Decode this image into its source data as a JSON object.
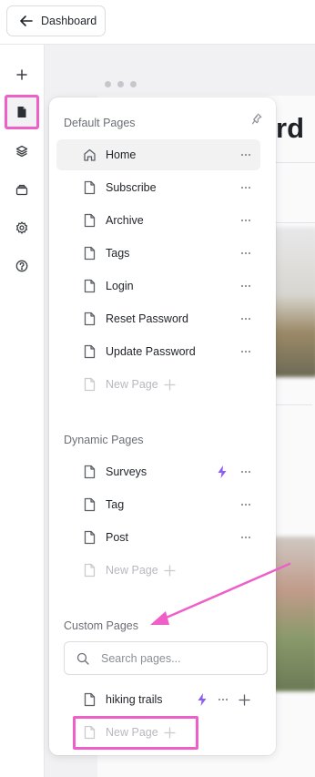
{
  "topbar": {
    "back_label": "Dashboard"
  },
  "canvas": {
    "partial_heading": "rd"
  },
  "panel": {
    "default_title": "Default Pages",
    "default_pages": [
      {
        "label": "Home"
      },
      {
        "label": "Subscribe"
      },
      {
        "label": "Archive"
      },
      {
        "label": "Tags"
      },
      {
        "label": "Login"
      },
      {
        "label": "Reset Password"
      },
      {
        "label": "Update Password"
      }
    ],
    "dynamic_title": "Dynamic Pages",
    "dynamic_pages": [
      {
        "label": "Surveys"
      },
      {
        "label": "Tag"
      },
      {
        "label": "Post"
      }
    ],
    "custom_title": "Custom Pages",
    "search_placeholder": "Search pages...",
    "custom_pages": [
      {
        "label": "hiking trails"
      }
    ],
    "new_page_label": "New Page"
  },
  "colors": {
    "highlight": "#ef5fc8",
    "bolt": "#8b5cf6"
  },
  "icons": [
    "arrow-left-icon",
    "plus-icon",
    "file-icon",
    "layers-icon",
    "archive-icon",
    "gear-icon",
    "help-icon",
    "pin-icon",
    "home-icon",
    "more-icon",
    "bolt-icon",
    "search-icon"
  ]
}
